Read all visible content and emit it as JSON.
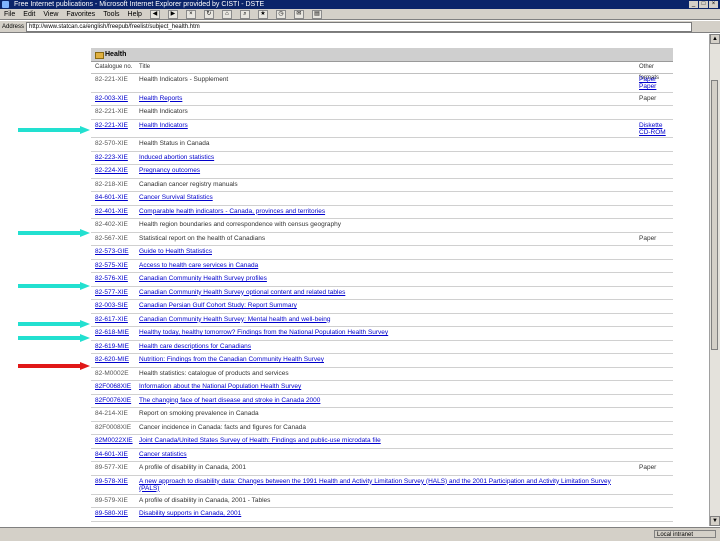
{
  "window": {
    "title": "Free Internet publications - Microsoft Internet Explorer provided by CISTI - DSTE"
  },
  "menu": {
    "items": [
      "File",
      "Edit",
      "View",
      "Favorites",
      "Tools",
      "Help"
    ]
  },
  "address": {
    "label": "Address",
    "url": "http://www.statcan.ca/english/freepub/freelist/subject_health.htm"
  },
  "section": {
    "title": "Health"
  },
  "columns": {
    "catalogue": "Catalogue no.",
    "title": "Title",
    "other": "Other formats"
  },
  "rows": [
    {
      "cat": "82-221-XIE",
      "title": "Health Indicators - Supplement",
      "other": "Paper",
      "other2": "Paper",
      "link": false,
      "other_link": true
    },
    {
      "cat": "82-003-XIE",
      "title": "Health Reports",
      "other": "Paper",
      "link": true
    },
    {
      "cat": "82-221-XIE",
      "title": "Health Indicators",
      "other": "",
      "link": false
    },
    {
      "cat": "82-221-XIE",
      "title": "Health Indicators",
      "other": "Diskette",
      "other2": "CD-ROM",
      "link": true,
      "other_link": true
    },
    {
      "cat": "82-570-XIE",
      "title": "Health Status in Canada",
      "other": "",
      "link": false
    },
    {
      "cat": "82-223-XIE",
      "title": "Induced abortion statistics",
      "other": "",
      "link": true
    },
    {
      "cat": "82-224-XIE",
      "title": "Pregnancy outcomes",
      "other": "",
      "link": true
    },
    {
      "cat": "82-218-XIE",
      "title": "Canadian cancer registry manuals",
      "other": "",
      "link": false
    },
    {
      "cat": "84-601-XIE",
      "title": "Cancer Survival Statistics",
      "other": "",
      "link": true
    },
    {
      "cat": "82-401-XIE",
      "title": "Comparable health indicators - Canada, provinces and territories",
      "other": "",
      "link": true
    },
    {
      "cat": "82-402-XIE",
      "title": "Health region boundaries and correspondence with census geography",
      "other": "",
      "link": false
    },
    {
      "cat": "82-567-XIE",
      "title": "Statistical report on the health of Canadians",
      "other": "Paper",
      "link": false
    },
    {
      "cat": "82-573-GIE",
      "title": "Guide to Health Statistics",
      "other": "",
      "link": true
    },
    {
      "cat": "82-575-XIE",
      "title": "Access to health care services in Canada",
      "other": "",
      "link": true
    },
    {
      "cat": "82-576-XIE",
      "title": "Canadian Community Health Survey profiles",
      "other": "",
      "link": true
    },
    {
      "cat": "82-577-XIE",
      "title": "Canadian Community Health Survey optional content and related tables",
      "other": "",
      "link": true
    },
    {
      "cat": "82-003-SIE",
      "title": "Canadian Persian Gulf Cohort Study: Report Summary",
      "other": "",
      "link": true
    },
    {
      "cat": "82-617-XIE",
      "title": "Canadian Community Health Survey: Mental health and well-being",
      "other": "",
      "link": true
    },
    {
      "cat": "82-618-MIE",
      "title": "Healthy today, healthy tomorrow? Findings from the National Population Health Survey",
      "other": "",
      "link": true
    },
    {
      "cat": "82-619-MIE",
      "title": "Health care descriptions for Canadians",
      "other": "",
      "link": true
    },
    {
      "cat": "82-620-MIE",
      "title": "Nutrition: Findings from the Canadian Community Health Survey",
      "other": "",
      "link": true
    },
    {
      "cat": "82-M0002E",
      "title": "Health statistics: catalogue of products and services",
      "other": "",
      "link": false
    },
    {
      "cat": "82F0068XIE",
      "title": "Information about the National Population Health Survey",
      "other": "",
      "link": true
    },
    {
      "cat": "82F0076XIE",
      "title": "The changing face of heart disease and stroke in Canada 2000",
      "other": "",
      "link": true
    },
    {
      "cat": "84-214-XIE",
      "title": "Report on smoking prevalence in Canada",
      "other": "",
      "link": false
    },
    {
      "cat": "82F0008XIE",
      "title": "Cancer incidence in Canada: facts and figures for Canada",
      "other": "",
      "link": false
    },
    {
      "cat": "82M0022XIE",
      "title": "Joint Canada/United States Survey of Health: Findings and public-use microdata file",
      "other": "",
      "link": true
    },
    {
      "cat": "84-601-XIE",
      "title": "Cancer statistics",
      "other": "",
      "link": true
    },
    {
      "cat": "89-577-XIE",
      "title": "A profile of disability in Canada, 2001",
      "other": "Paper",
      "link": false
    },
    {
      "cat": "89-578-XIE",
      "title": "A new approach to disability data: Changes between the 1991 Health and Activity Limitation Survey (HALS) and the 2001 Participation and Activity Limitation Survey (PALS)",
      "other": "",
      "link": true,
      "tall": true
    },
    {
      "cat": "89-579-XIE",
      "title": "A profile of disability in Canada, 2001 - Tables",
      "other": "",
      "link": false
    },
    {
      "cat": "89-580-XIE",
      "title": "Disability supports in Canada, 2001",
      "other": "",
      "link": true
    }
  ],
  "annotations": {
    "cyan": "#22e0d0",
    "red": "#e01818"
  },
  "status": {
    "zone": "Local intranet"
  }
}
